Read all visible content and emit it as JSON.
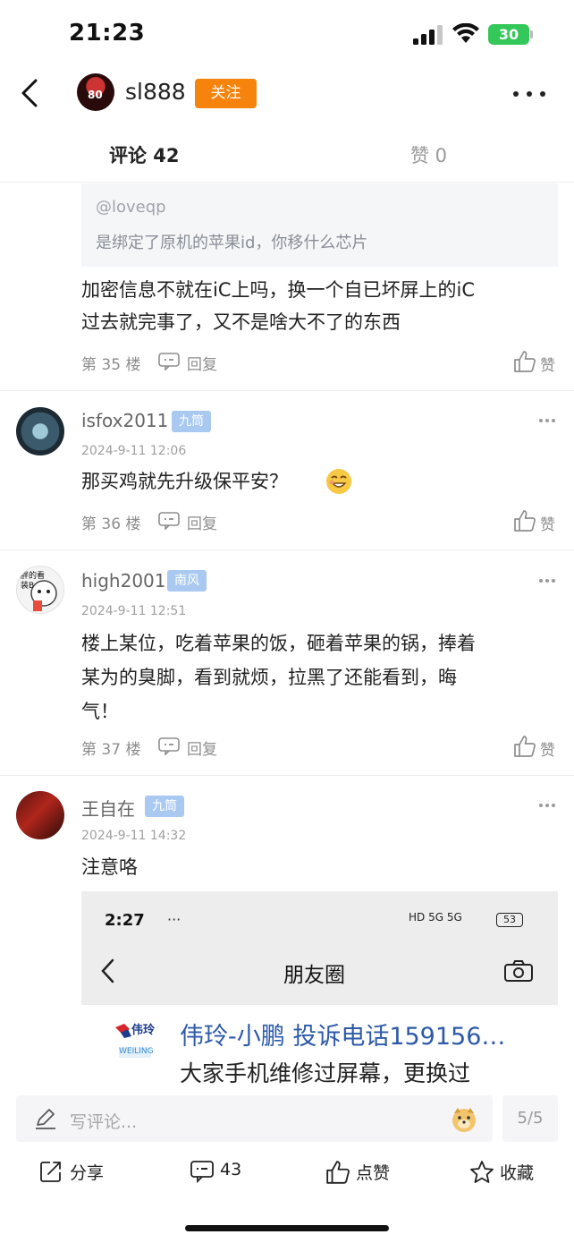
{
  "status_bar": {
    "time": "21:23",
    "battery": "30"
  },
  "header": {
    "username": "sl888",
    "follow_label": "关注"
  },
  "tabs": {
    "comments": "评论 42",
    "likes": "赞 0"
  },
  "comments": [
    {
      "quote": {
        "user": "@loveqp",
        "text": "是绑定了原机的苹果id，你移什么芯片"
      },
      "lines": [
        "加密信息不就在iC上吗，换一个自已坏屏上的iC",
        "过去就完事了，又不是啥大不了的东西"
      ],
      "floor": "第 35 楼",
      "reply_label": "回复",
      "like_label": "赞"
    },
    {
      "name": "isfox2011",
      "badge": "九筒",
      "date": "2024-9-11 12:06",
      "lines": [
        "那买鸡就先升级保平安？"
      ],
      "emoji": "shy-grin-emoji",
      "floor": "第 36 楼",
      "reply_label": "回复",
      "like_label": "赞"
    },
    {
      "name": "high2001",
      "badge": "南风",
      "date": "2024-9-11 12:51",
      "lines": [
        "楼上某位，吃着苹果的饭，砸着苹果的锅，捧着",
        "某为的臭脚，看到就烦，拉黑了还能看到，晦",
        "气！"
      ],
      "floor": "第 37 楼",
      "reply_label": "回复",
      "like_label": "赞"
    },
    {
      "name": "王自在",
      "badge": "九筒",
      "date": "2024-9-11 14:32",
      "lines": [
        "注意咯"
      ],
      "image": {
        "time": "2:27",
        "dots": "···",
        "status": "HD 5G 5G",
        "battery": "53",
        "title": "朋友圈",
        "logo_text": "伟玲",
        "logo_sub": "WEILING",
        "line1": "伟玲-小鹏 投诉电话159156…",
        "line2": "大家手机维修过屏幕，更换过"
      }
    }
  ],
  "bottom_bar": {
    "placeholder": "写评论...",
    "page": "5/5",
    "share": "分享",
    "comment_count": "43",
    "like": "点赞",
    "favorite": "收藏"
  },
  "colors": {
    "accent": "#f5830c",
    "badge": "#a9c9f1",
    "battery": "#34c759"
  }
}
